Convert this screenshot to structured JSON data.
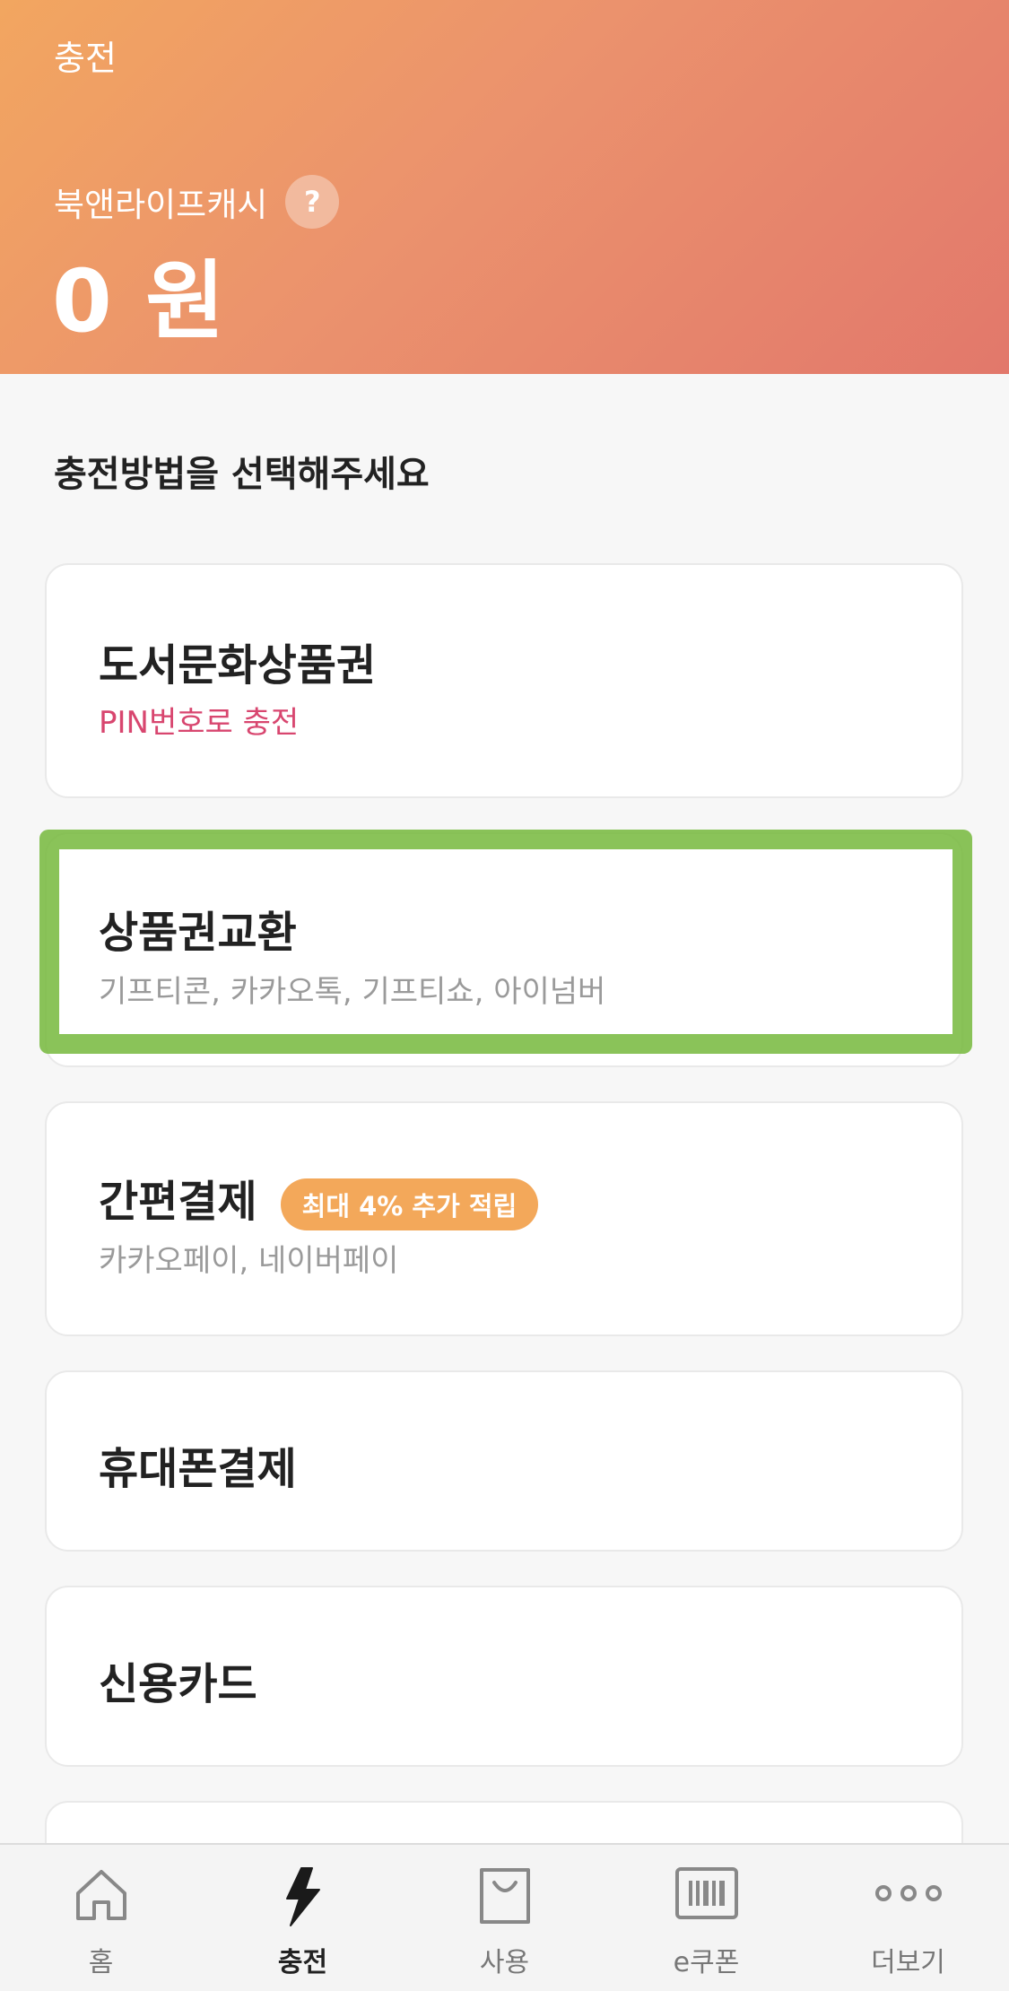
{
  "header": {
    "title": "충전",
    "cash_label": "북앤라이프캐시",
    "help_badge": "?",
    "balance": "0 원"
  },
  "section_title": "충전방법을 선택해주세요",
  "methods": [
    {
      "title": "도서문화상품권",
      "subtitle": "PIN번호로 충전"
    },
    {
      "title": "상품권교환",
      "subtitle": "기프티콘, 카카오톡, 기프티쇼, 아이넘버"
    },
    {
      "title": "간편결제",
      "badge": "최대 4% 추가 적립",
      "subtitle": "카카오페이, 네이버페이"
    },
    {
      "title": "휴대폰결제"
    },
    {
      "title": "신용카드"
    }
  ],
  "tabs": [
    {
      "label": "홈",
      "icon": "home-icon"
    },
    {
      "label": "충전",
      "icon": "lightning-icon",
      "active": true
    },
    {
      "label": "사용",
      "icon": "shopping-bag-icon"
    },
    {
      "label": "e쿠폰",
      "icon": "barcode-icon"
    },
    {
      "label": "더보기",
      "icon": "more-dots-icon"
    }
  ],
  "colors": {
    "header_gradient_start": "#f2a660",
    "header_gradient_end": "#e2786b",
    "accent_pink": "#d8466f",
    "badge_orange": "#f3a85a",
    "highlight_green": "#76b93c"
  }
}
